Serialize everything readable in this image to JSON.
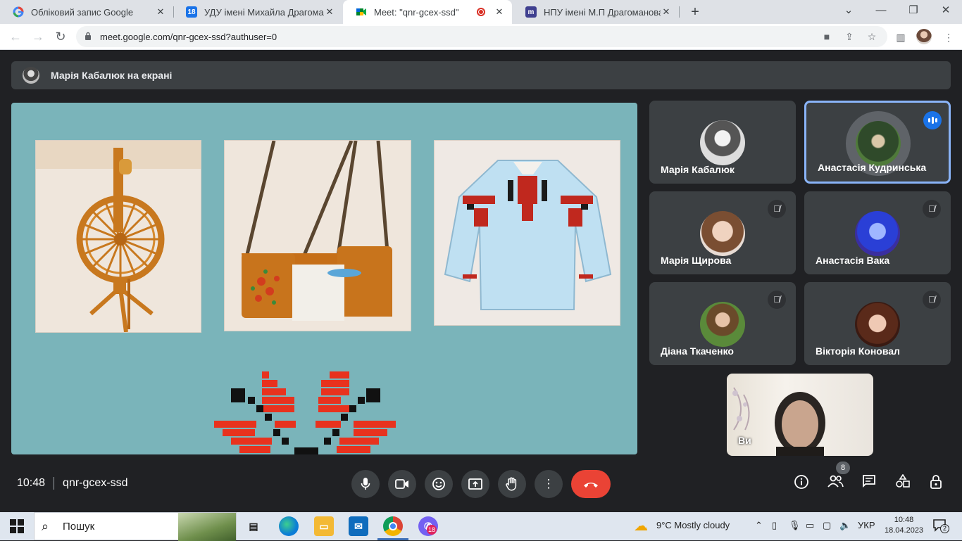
{
  "browser": {
    "tabs": [
      {
        "title": "Обліковий запис Google",
        "favicon": "google-g-icon"
      },
      {
        "title": "УДУ імені Михайла Драгоманова",
        "favicon": "calendar-icon"
      },
      {
        "title": "Meet: \"qnr-gcex-ssd\"",
        "favicon": "meet-icon"
      },
      {
        "title": "НПУ імені М.П Драгоманова",
        "favicon": "moodle-icon"
      }
    ],
    "url": "meet.google.com/qnr-gcex-ssd?authuser=0"
  },
  "meet": {
    "presenter_label": "Марія Кабалюк на екрані",
    "participants": [
      {
        "name": "Марія Кабалюк",
        "muted": false,
        "speaking": false
      },
      {
        "name": "Анастасія Кудринська",
        "muted": false,
        "speaking": true
      },
      {
        "name": "Марія Щирова",
        "muted": true,
        "speaking": false
      },
      {
        "name": "Анастасія Вака",
        "muted": true,
        "speaking": false
      },
      {
        "name": "Діана Ткаченко",
        "muted": true,
        "speaking": false
      },
      {
        "name": "Вікторія Коновал",
        "muted": true,
        "speaking": false
      }
    ],
    "self_label": "Ви",
    "time": "10:48",
    "meeting_code": "qnr-gcex-ssd",
    "people_count": "8"
  },
  "taskbar": {
    "search_placeholder": "Пошук",
    "weather": "9°C  Mostly cloudy",
    "language": "УКР",
    "time": "10:48",
    "date": "18.04.2023",
    "viber_badge": "18",
    "notifications": "2"
  },
  "colors": {
    "meet_bg": "#202124",
    "tile_bg": "#3c4043",
    "slide_bg": "#7ab4ba",
    "end_call": "#ea4335",
    "accent": "#1a73e8"
  }
}
